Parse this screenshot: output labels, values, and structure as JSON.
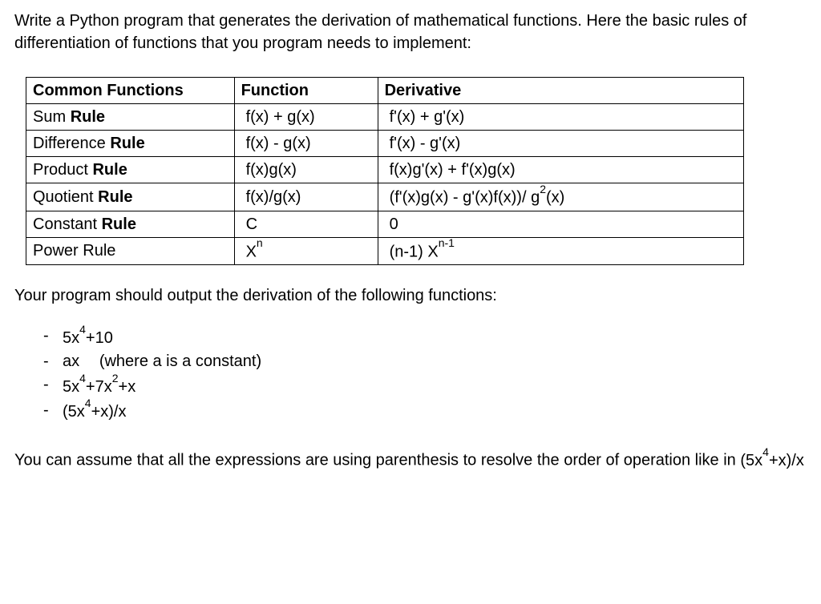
{
  "intro": "Write a Python program that generates the derivation of mathematical functions. Here the basic rules of differentiation of functions that you program needs to implement:",
  "table": {
    "headers": {
      "c0": "Common Functions",
      "c1": "Function",
      "c2": "Derivative"
    },
    "rows": [
      {
        "name_pre": "Sum ",
        "name_bold": "Rule",
        "func": "f(x) + g(x)",
        "deriv": "f'(x) + g'(x)"
      },
      {
        "name_pre": "Difference ",
        "name_bold": "Rule",
        "func": "f(x) - g(x)",
        "deriv": "f'(x) - g'(x)"
      },
      {
        "name_pre": "Product ",
        "name_bold": "Rule",
        "func": "f(x)g(x)",
        "deriv": "f(x)g'(x) + f'(x)g(x)"
      },
      {
        "name_pre": "Quotient ",
        "name_bold": "Rule",
        "func": "f(x)/g(x)",
        "deriv_html": "(f'(x)g(x) - g'(x)f(x))/ g<sup>2</sup>(x)"
      },
      {
        "name_pre": "Constant ",
        "name_bold": "Rule",
        "func": "C",
        "deriv": "0"
      },
      {
        "name_pre": "Power Rule",
        "name_bold": "",
        "func_html": "X<sup>n</sup>",
        "deriv_html": "(n-1) X<sup>n-1</sup>"
      }
    ]
  },
  "subsection": "Your program should output the derivation of the following functions:",
  "examples": [
    {
      "html": "5x<sup>4</sup>+10"
    },
    {
      "text": "ax",
      "note": "(where a is a constant)"
    },
    {
      "html": "5x<sup>4</sup>+7x<sup>2</sup>+x"
    },
    {
      "html": "(5x<sup>4</sup>+x)/x"
    }
  ],
  "closing_pre": "You can assume that all the expressions are using parenthesis to resolve the order of operation like in ",
  "closing_expr_html": "(5x<sup>4</sup>+x)/x"
}
